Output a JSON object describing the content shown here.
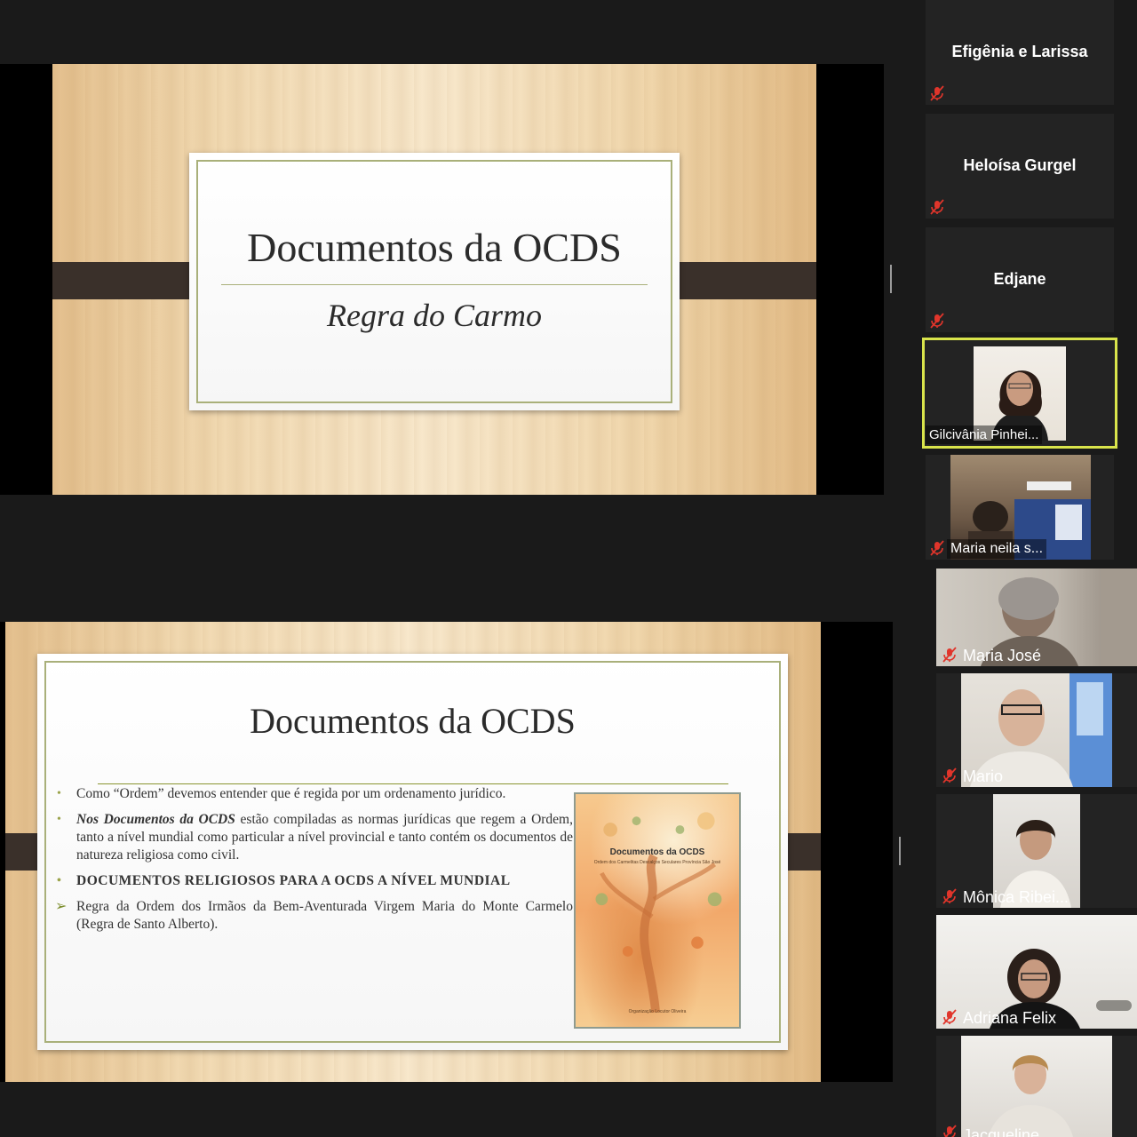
{
  "slide1": {
    "title": "Documentos da OCDS",
    "subtitle": "Regra do Carmo"
  },
  "slide2": {
    "title": "Documentos da OCDS",
    "bullets": [
      {
        "text": "Como “Ordem” devemos entender que é regida por um ordenamento jurídico."
      },
      {
        "lead": "Nos Documentos da OCDS",
        "text": " estão compiladas as normas jurídicas que regem a Ordem, tanto a nível mundial como particular a nível provincial e tanto contém os documentos de natureza religiosa como civil."
      },
      {
        "text": "DOCUMENTOS RELIGIOSOS PARA A OCDS A NÍVEL MUNDIAL"
      },
      {
        "text": "Regra da Ordem dos Irmãos da Bem-Aventurada Virgem Maria do Monte Carmelo (Regra de Santo Alberto)."
      }
    ],
    "book": {
      "title": "Documentos da OCDS",
      "subtitle": "Ordem dos Carmelitas Descalços Seculares Província São José",
      "footer": "Organização Locutor Oliveira"
    }
  },
  "participants": [
    {
      "name": "Efigênia e Larissa",
      "muted": true,
      "video": false
    },
    {
      "name": "Heloísa Gurgel",
      "muted": true,
      "video": false
    },
    {
      "name": "Edjane",
      "muted": true,
      "video": false
    },
    {
      "name": "Gilcivânia Pinhei...",
      "muted": false,
      "video": true,
      "speaking": true
    },
    {
      "name": "Maria neila s...",
      "muted": true,
      "video": true
    },
    {
      "name": "Maria José",
      "muted": true,
      "video": true
    },
    {
      "name": "Mario",
      "muted": true,
      "video": true
    },
    {
      "name": "Mônica Ribei...",
      "muted": true,
      "video": true
    },
    {
      "name": "Adriana Felix",
      "muted": true,
      "video": true
    },
    {
      "name": "Jacqueline...",
      "muted": true,
      "video": true
    }
  ],
  "colors": {
    "background": "#1a1a1a",
    "speaking_border": "#d9e44b",
    "muted_icon": "#e0352b",
    "slide_accent": "#a9b07a"
  }
}
